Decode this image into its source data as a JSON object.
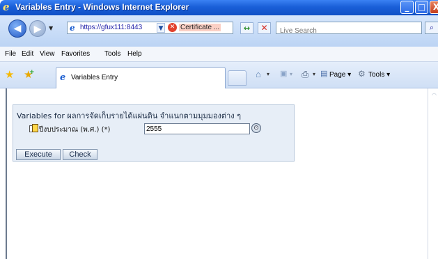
{
  "window": {
    "title": "Variables Entry - Windows Internet Explorer",
    "controls": {
      "minimize": "_",
      "maximize": "□",
      "close": "X"
    }
  },
  "toolbar": {
    "back": "◀",
    "forward": "▶",
    "history_dropdown": "▼",
    "address": "https://gfux111:8443",
    "address_dropdown": "▼",
    "certificate": "Certificate ...",
    "refresh": "↔",
    "stop": "✕",
    "search_placeholder": "Live Search",
    "search_button": "⌕"
  },
  "menu": {
    "items": [
      "File",
      "Edit",
      "View",
      "Favorites",
      "Tools",
      "Help"
    ]
  },
  "tabs": {
    "active_label": "Variables Entry",
    "commands": {
      "page": "Page ▾",
      "tools": "Tools ▾"
    }
  },
  "panel": {
    "header": "Variables for ผลการจัดเก็บรายได้แผ่นดิน จำแนกตามมุมมองต่าง ๆ",
    "field_label": "ปีงบประมาณ (พ.ศ.) (*)",
    "field_value": "2555",
    "execute_label": "Execute",
    "check_label": "Check"
  }
}
